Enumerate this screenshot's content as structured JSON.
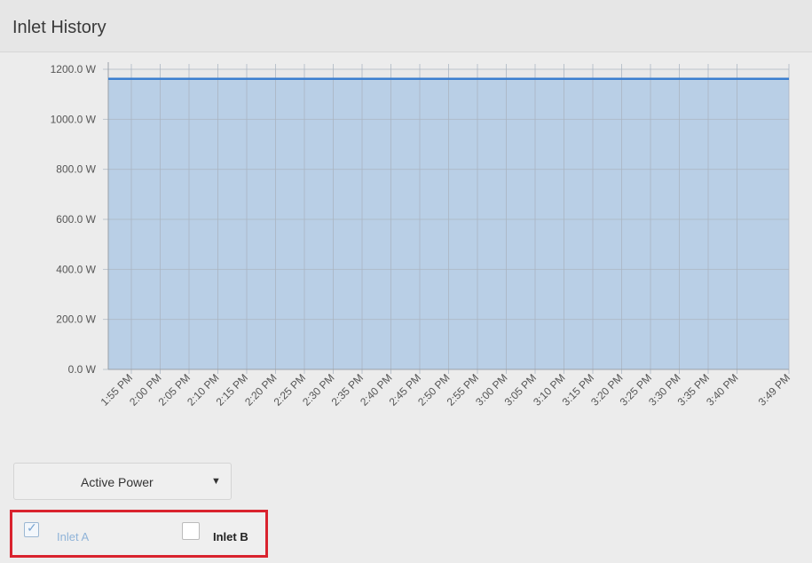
{
  "header": {
    "title": "Inlet History"
  },
  "chart_data": {
    "type": "area",
    "title": "",
    "xlabel": "",
    "ylabel": "",
    "ylim": [
      0,
      1200
    ],
    "yticks": [
      0,
      200,
      400,
      600,
      800,
      1000,
      1200
    ],
    "ytick_labels": [
      "0.0 W",
      "200.0 W",
      "400.0 W",
      "600.0 W",
      "800.0 W",
      "1000.0 W",
      "1200.0 W"
    ],
    "x_tick_labels": [
      "1:55 PM",
      "2:00 PM",
      "2:05 PM",
      "2:10 PM",
      "2:15 PM",
      "2:20 PM",
      "2:25 PM",
      "2:30 PM",
      "2:35 PM",
      "2:40 PM",
      "2:45 PM",
      "2:50 PM",
      "2:55 PM",
      "3:00 PM",
      "3:05 PM",
      "3:10 PM",
      "3:15 PM",
      "3:20 PM",
      "3:25 PM",
      "3:30 PM",
      "3:35 PM",
      "3:40 PM",
      "3:49 PM"
    ],
    "x_tick_minutes": [
      115,
      120,
      125,
      130,
      135,
      140,
      145,
      150,
      155,
      160,
      165,
      170,
      175,
      180,
      185,
      190,
      195,
      200,
      205,
      210,
      215,
      220,
      229
    ],
    "grid": true,
    "series": [
      {
        "name": "Inlet A",
        "color": "#3c7fd0",
        "fill": "#b9cfe6",
        "x": [
          111,
          229
        ],
        "values": [
          1162,
          1162
        ]
      }
    ]
  },
  "controls": {
    "metric_label": "Active Power",
    "arrow": "▼",
    "legend": [
      {
        "label": "Inlet A",
        "checked": true,
        "check_symbol": "✓"
      },
      {
        "label": "Inlet B",
        "checked": false
      }
    ]
  }
}
